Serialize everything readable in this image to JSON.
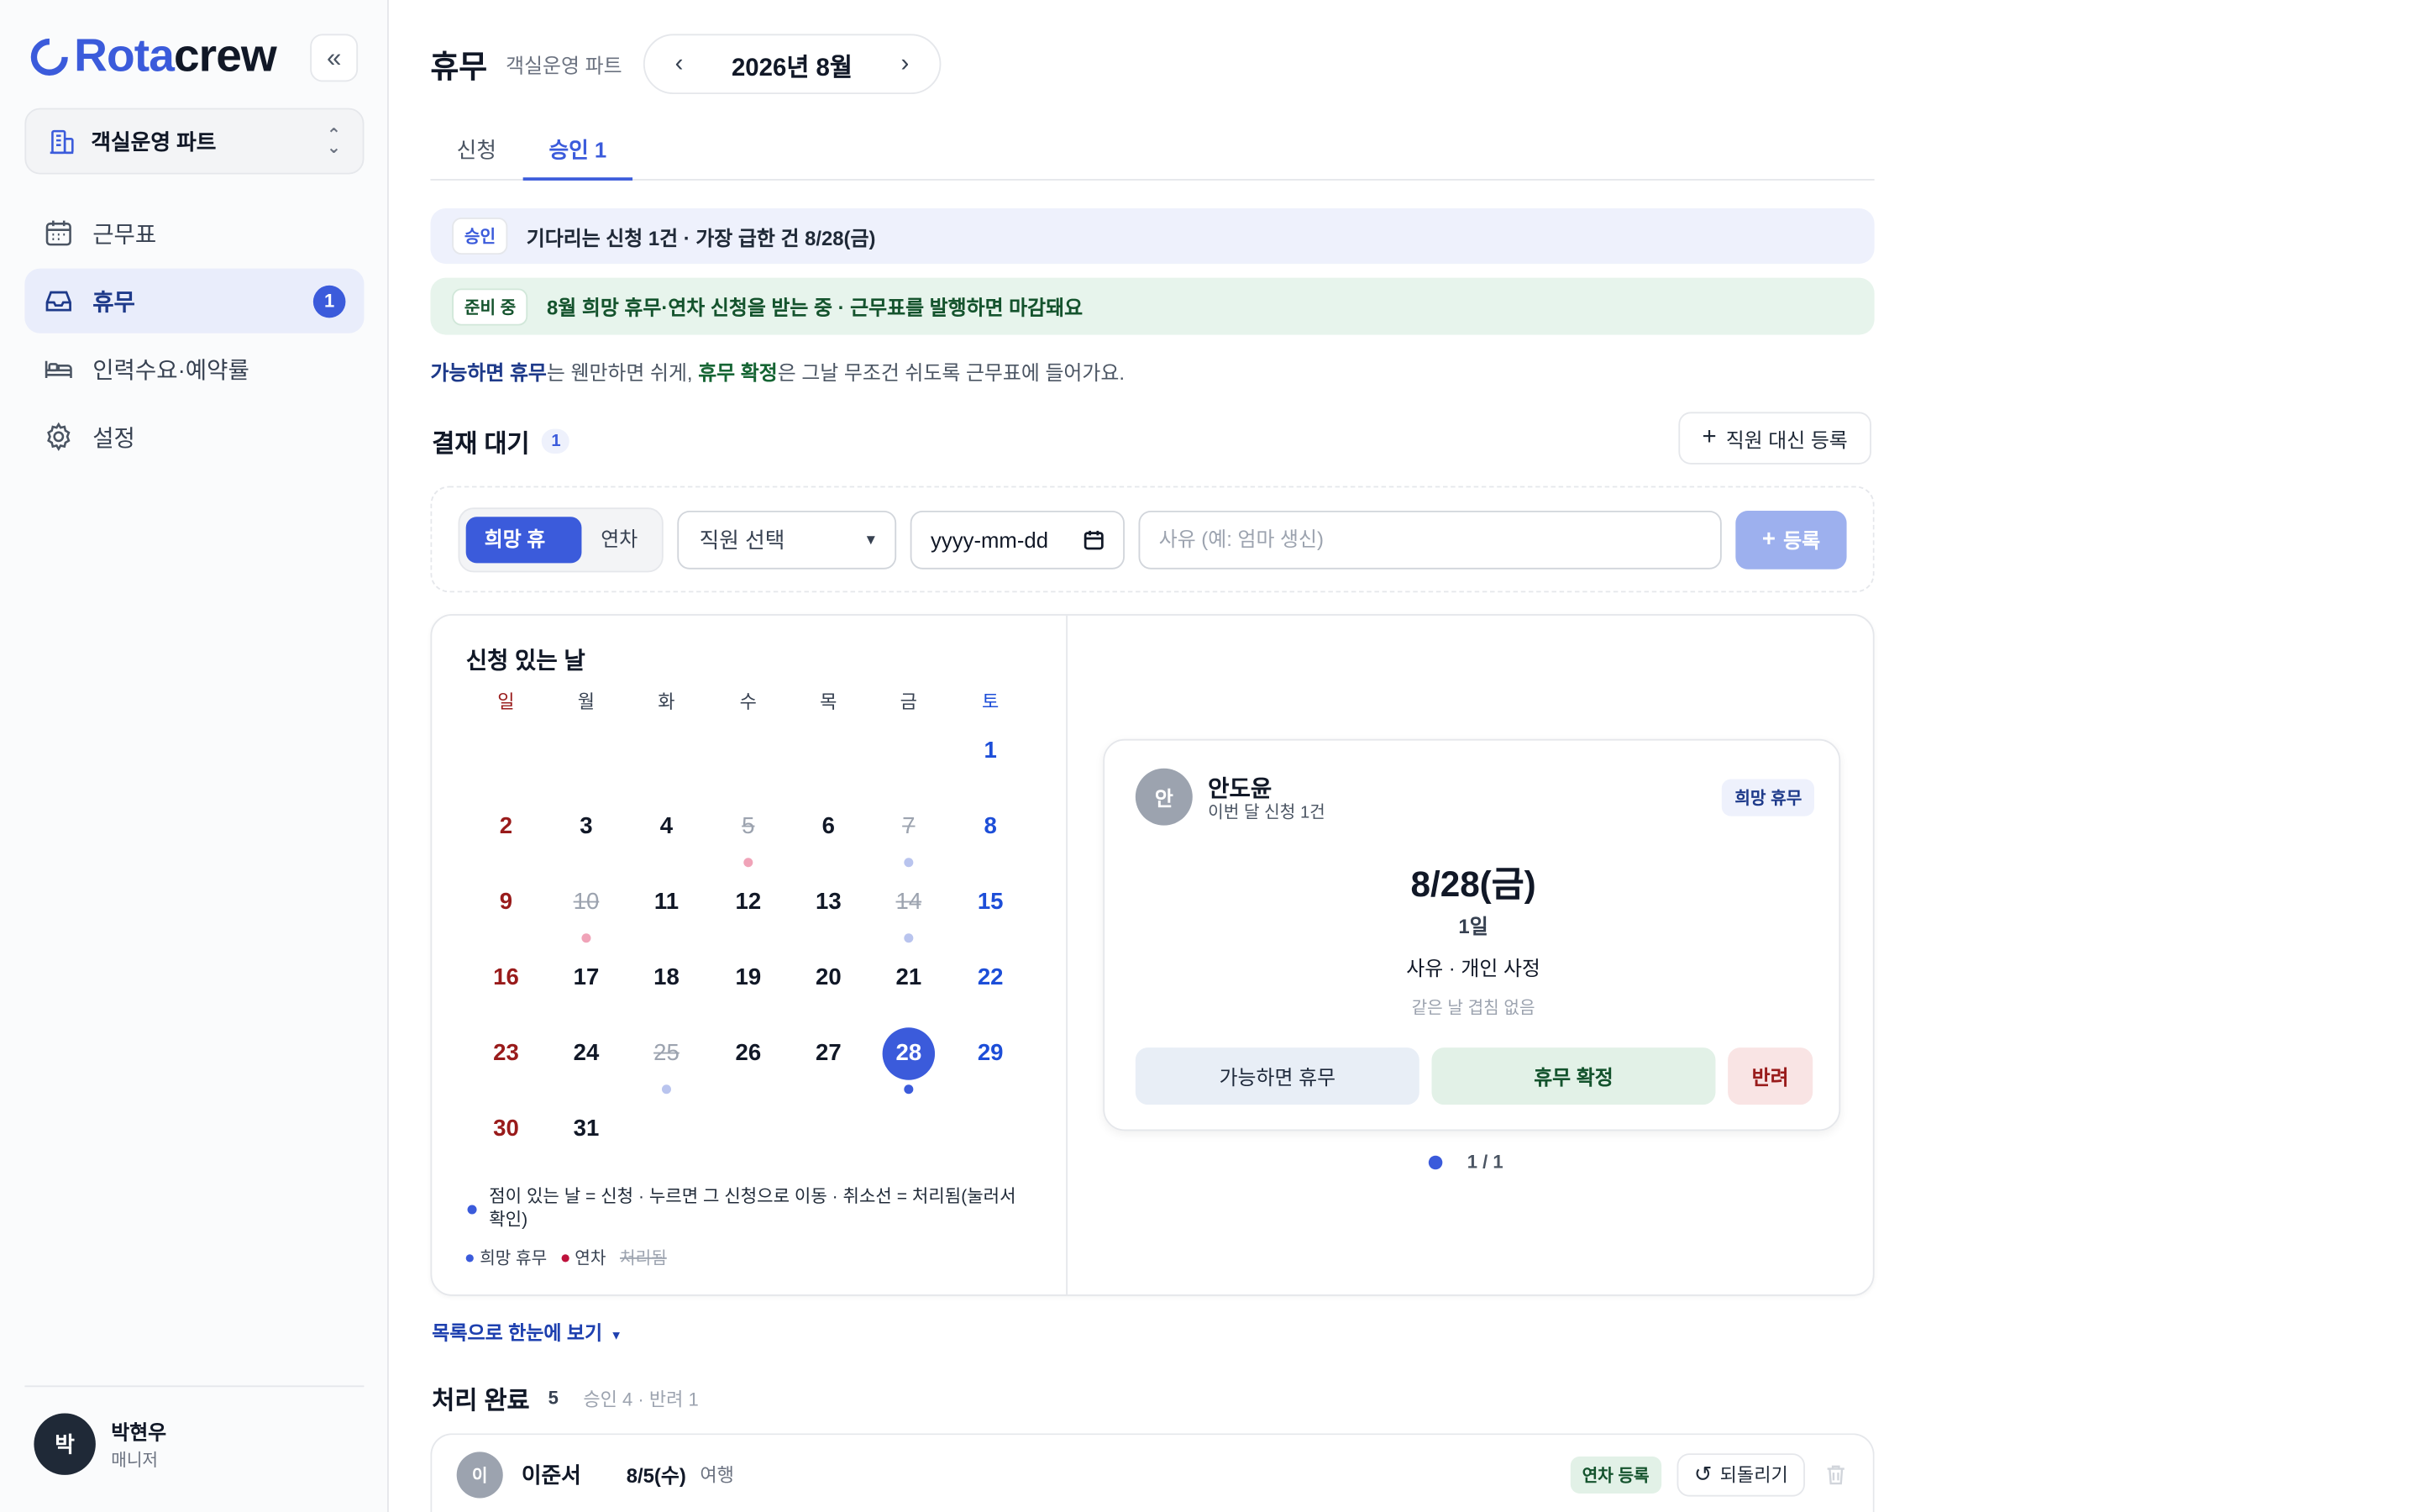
{
  "brand": {
    "part1": "Rota",
    "part2": "crew"
  },
  "org_selector": {
    "label": "객실운영 파트"
  },
  "nav": [
    {
      "label": "근무표",
      "icon": "calendar-icon"
    },
    {
      "label": "휴무",
      "icon": "inbox-icon",
      "badge": "1",
      "active": true
    },
    {
      "label": "인력수요·예약률",
      "icon": "bed-icon"
    },
    {
      "label": "설정",
      "icon": "gear-icon"
    }
  ],
  "user": {
    "initial": "박",
    "name": "박현우",
    "role": "매니저"
  },
  "header": {
    "title": "휴무",
    "subtitle": "객실운영 파트",
    "month": "2026년 8월"
  },
  "tabs": [
    {
      "label": "신청"
    },
    {
      "label": "승인 1",
      "active": true
    }
  ],
  "banners": {
    "approval": {
      "chip": "승인",
      "text": "기다리는 신청 1건 · 가장 급한 건 8/28(금)"
    },
    "preparing": {
      "chip": "준비 중",
      "text": "8월 희망 휴무·연차 신청을 받는 중 · 근무표를 발행하면 마감돼요"
    }
  },
  "note": {
    "b1": "가능하면 휴무",
    "t1": "는 웬만하면 쉬게, ",
    "b2": "휴무 확정",
    "t2": "은 그날 무조건 쉬도록 근무표에 들어가요."
  },
  "pending": {
    "title": "결재 대기",
    "count": "1",
    "add_label": "직원 대신 등록"
  },
  "form": {
    "type_options": [
      "희망 휴무",
      "연차"
    ],
    "employee_placeholder": "직원 선택",
    "date_placeholder": "yyyy-mm-dd",
    "reason_placeholder": "사유 (예: 엄마 생신)",
    "submit_label": "등록"
  },
  "calendar": {
    "title": "신청 있는 날",
    "weekdays": [
      "일",
      "월",
      "화",
      "수",
      "목",
      "금",
      "토"
    ],
    "first_weekday": 6,
    "days_in_month": 31,
    "selected": 28,
    "processed": [
      5,
      7,
      10,
      14,
      25
    ],
    "marks": {
      "5": "leave-done",
      "7": "wish-done",
      "10": "leave-done",
      "14": "wish-done",
      "25": "wish-done",
      "28": "wish"
    },
    "legend_main": "점이 있는 날 = 신청 · 누르면 그 신청으로 이동 · 취소선 = 처리됨(눌러서 확인)",
    "legend_items": [
      "희망 휴무",
      "연차",
      "처리됨"
    ]
  },
  "request_card": {
    "initial": "안",
    "name": "안도윤",
    "sub": "이번 달 신청 1건",
    "tag": "희망 휴무",
    "date": "8/28(금)",
    "duration": "1일",
    "reason": "사유 · 개인 사정",
    "overlap": "같은 날 겹침 없음",
    "actions": {
      "maybe": "가능하면 휴무",
      "confirm": "휴무 확정",
      "reject": "반려"
    }
  },
  "pager": {
    "text": "1 / 1"
  },
  "list_link": "목록으로 한눈에 보기",
  "processed": {
    "title": "처리 완료",
    "count": "5",
    "summary": "승인 4 · 반려 1",
    "rows": [
      {
        "initial": "이",
        "name": "이준서",
        "date": "8/5(수)",
        "reason": "여행",
        "tag": "연차 등록",
        "undo": "되돌리기"
      }
    ]
  },
  "colors": {
    "accent": "#3b5bdb",
    "wish_dot": "#3b5bdb",
    "leave_dot": "#be123c",
    "confirm_bg": "#e2f1e7",
    "reject_bg": "#f9e4e4"
  }
}
